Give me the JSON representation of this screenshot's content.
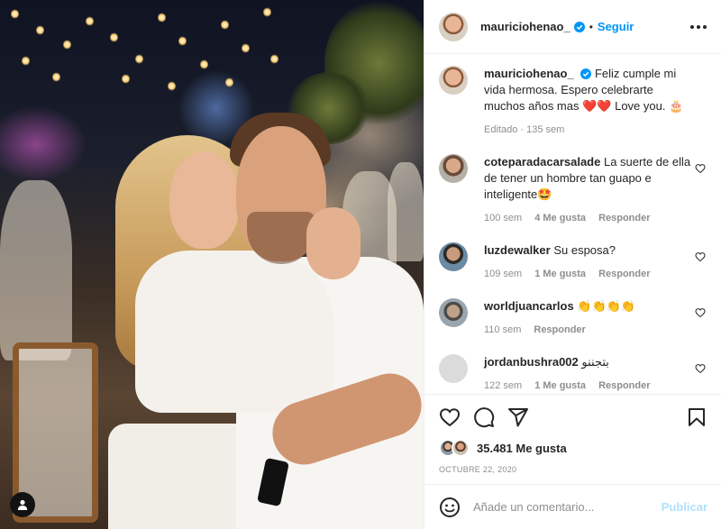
{
  "post": {
    "author": "mauriciohenao_",
    "follow_label": "Seguir",
    "dot": "•",
    "caption_text": "Feliz cumple mi vida hermosa. Espero celebrarte muchos años mas ❤️❤️ Love you. 🎂",
    "caption_meta": "Editado · 135 sem"
  },
  "comments": [
    {
      "user": "coteparadacarsalade",
      "text": "La suerte de ella de tener un hombre tan guapo e inteligente🤩",
      "time": "100 sem",
      "likes": "4 Me gusta",
      "reply": "Responder"
    },
    {
      "user": "luzdewalker",
      "text": "Su esposa?",
      "time": "109 sem",
      "likes": "1 Me gusta",
      "reply": "Responder"
    },
    {
      "user": "worldjuancarlos",
      "text": "👏👏👏👏",
      "time": "110 sem",
      "likes": "",
      "reply": "Responder"
    },
    {
      "user": "jordanbushra002",
      "text": "بتجننو",
      "time": "122 sem",
      "likes": "1 Me gusta",
      "reply": "Responder"
    }
  ],
  "stats": {
    "likes": "35.481 Me gusta",
    "date": "OCTUBRE 22, 2020"
  },
  "composer": {
    "placeholder": "Añade un comentario...",
    "publish_label": "Publicar"
  },
  "colors": {
    "accent": "#0095f6",
    "publish_disabled": "#b2dffc",
    "muted_text": "#8e8e8e",
    "heart_red": "#e0245e"
  },
  "icons": [
    "verified-badge-icon",
    "more-options-icon",
    "heart-icon",
    "comment-icon",
    "share-icon",
    "bookmark-icon",
    "emoji-icon",
    "user-tag-icon"
  ]
}
